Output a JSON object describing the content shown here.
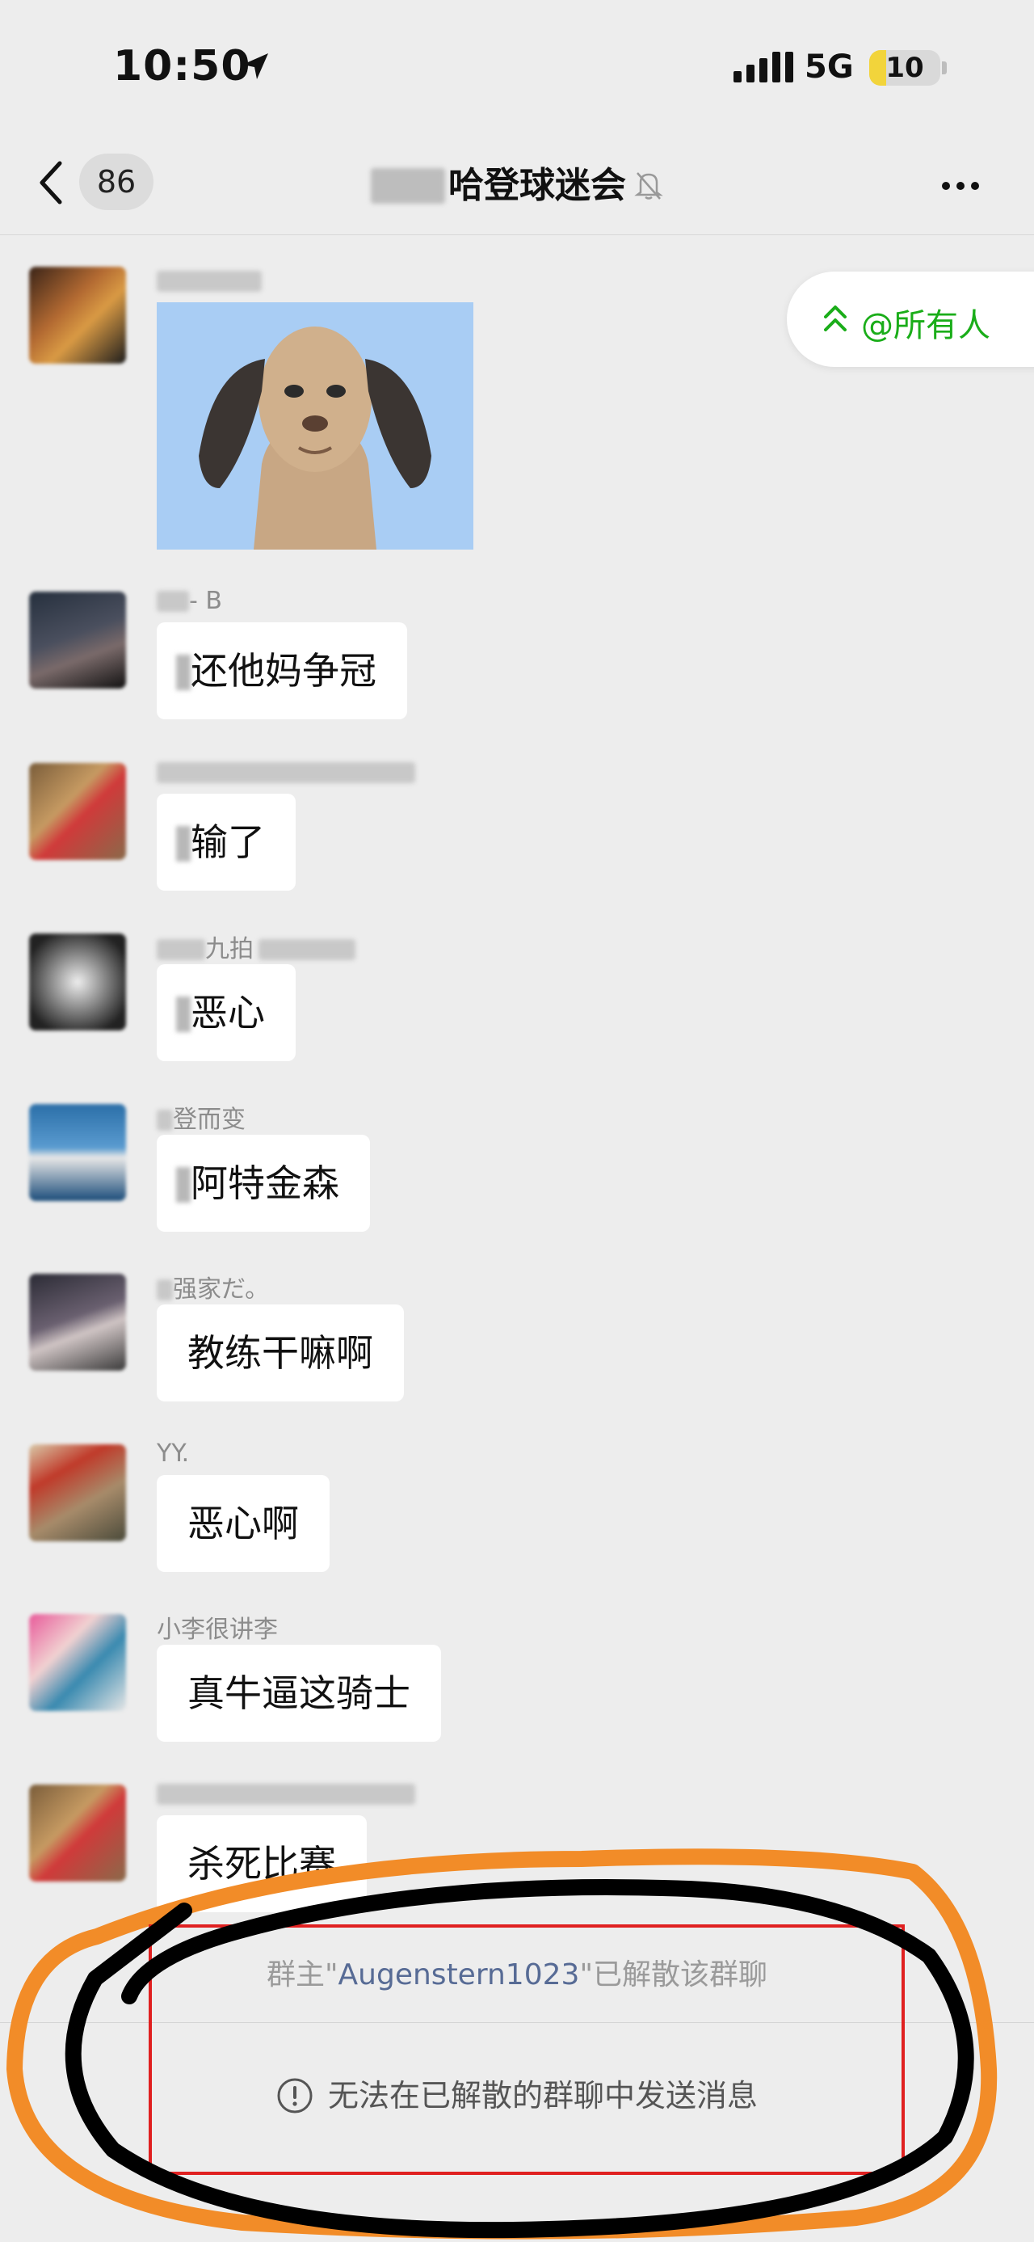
{
  "status_bar": {
    "time": "10:50",
    "network": "5G",
    "battery": "10"
  },
  "nav": {
    "back_count": "86",
    "title": "哈登球迷会"
  },
  "mention_all": {
    "label": "@所有人"
  },
  "messages": [
    {
      "sender": "",
      "text": ""
    },
    {
      "sender": "- B",
      "text": "还他妈争冠"
    },
    {
      "sender": "",
      "text": "输了"
    },
    {
      "sender": "九拍",
      "text": "恶心"
    },
    {
      "sender": "登而变",
      "text": "阿特金森"
    },
    {
      "sender": "强家だ。",
      "text": "教练干嘛啊"
    },
    {
      "sender": "YY.",
      "text": "恶心啊"
    },
    {
      "sender": "小李很讲李",
      "text": "真牛逼这骑士"
    },
    {
      "sender": "",
      "text": "杀死比赛"
    }
  ],
  "system": {
    "dissolved_prefix": "群主\"",
    "owner_name": "Augenstern1023",
    "dissolved_suffix": "\"已解散该群聊",
    "cannot_send": "无法在已解散的群聊中发送消息"
  },
  "colors": {
    "background": "#ededed",
    "bubble": "#ffffff",
    "mention_green": "#1aad19",
    "name_link": "#576b95",
    "annotation_orange": "#f28c28",
    "annotation_red": "#e02020",
    "annotation_black": "#000000"
  },
  "icons": [
    "location-arrow-icon",
    "signal-icon",
    "battery-icon",
    "back-chevron-icon",
    "mute-bell-icon",
    "more-icon",
    "double-chevron-up-icon",
    "warning-circle-icon"
  ]
}
